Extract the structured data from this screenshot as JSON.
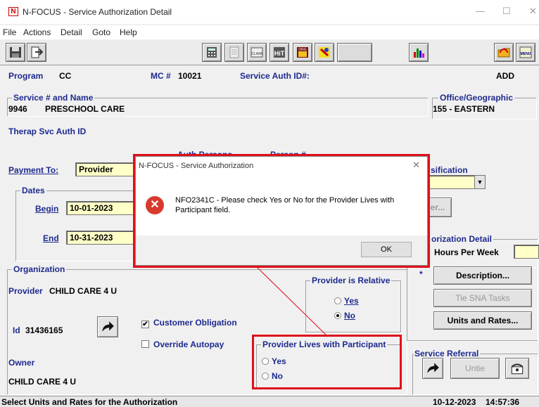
{
  "window": {
    "title": "N-FOCUS - Service Authorization Detail",
    "logo": "N",
    "minimize": "—",
    "maximize": "☐",
    "close": "✕"
  },
  "menu": [
    "File",
    "Actions",
    "Detail",
    "Goto",
    "Help"
  ],
  "toolbar_icons": [
    "save-icon",
    "exit-icon",
    "calculator-icon",
    "notes-icon",
    "claim-icon",
    "hit-icon",
    "org-icon",
    "color-icon",
    "chart-icon",
    "folder-icon",
    "menu-icon"
  ],
  "toolbar_text": {
    "claim": "CLAIM",
    "hit": "HiT",
    "org": "ORG",
    "menu": "MENU"
  },
  "header": {
    "program_label": "Program",
    "program_value": "CC",
    "mc_label": "MC #",
    "mc_value": "10021",
    "auth_id_label": "Service Auth ID#:",
    "mode": "ADD"
  },
  "service": {
    "legend": "Service # and Name",
    "number": "9946",
    "name": "PRESCHOOL CARE"
  },
  "office": {
    "legend": "Office/Geographic",
    "value": "155  - EASTERN"
  },
  "therap_label": "Therap Svc Auth ID",
  "auth_persons_label": "Auth Persons",
  "person_label": "Person #",
  "payment": {
    "label": "Payment To:",
    "value": "Provider"
  },
  "classification_label": "sification",
  "dates": {
    "legend": "Dates",
    "begin_label": "Begin",
    "begin_value": "10-01-2023",
    "end_label": "End",
    "end_value": "10-31-2023"
  },
  "partial_button": "er...",
  "auth_detail": {
    "legend": "orization Detail",
    "hours_label": "Hours Per Week"
  },
  "organization": {
    "legend": "Organization",
    "provider_label": "Provider",
    "provider_value": "CHILD CARE 4 U",
    "id_label": "Id",
    "id_value": "31436165",
    "owner_label": "Owner",
    "owner_value": "CHILD CARE 4 U"
  },
  "checks": {
    "customer_obligation": "Customer Obligation",
    "override_autopay": "Override Autopay"
  },
  "relative": {
    "legend": "Provider is Relative",
    "yes": "Yes",
    "no": "No",
    "selected": "No"
  },
  "lives_with": {
    "legend": "Provider Lives with Participant",
    "yes": "Yes",
    "no": "No"
  },
  "side_buttons": {
    "asterisk": "*",
    "description": "Description...",
    "tie": "Tie SNA Tasks",
    "units": "Units and Rates..."
  },
  "referral": {
    "legend": "Service Referral",
    "untie": "Untie"
  },
  "status": {
    "message": "Select Units and Rates for the Authorization",
    "date": "10-12-2023",
    "time": "14:57:36"
  },
  "dialog": {
    "title": "N-FOCUS - Service Authorization",
    "close": "✕",
    "message": "NFO2341C - Please check Yes or No for the Provider Lives with Participant field.",
    "ok": "OK"
  },
  "colors": {
    "label_blue": "#1d2a8f",
    "field_yellow": "#ffffc8",
    "highlight_red": "#e0101a"
  }
}
